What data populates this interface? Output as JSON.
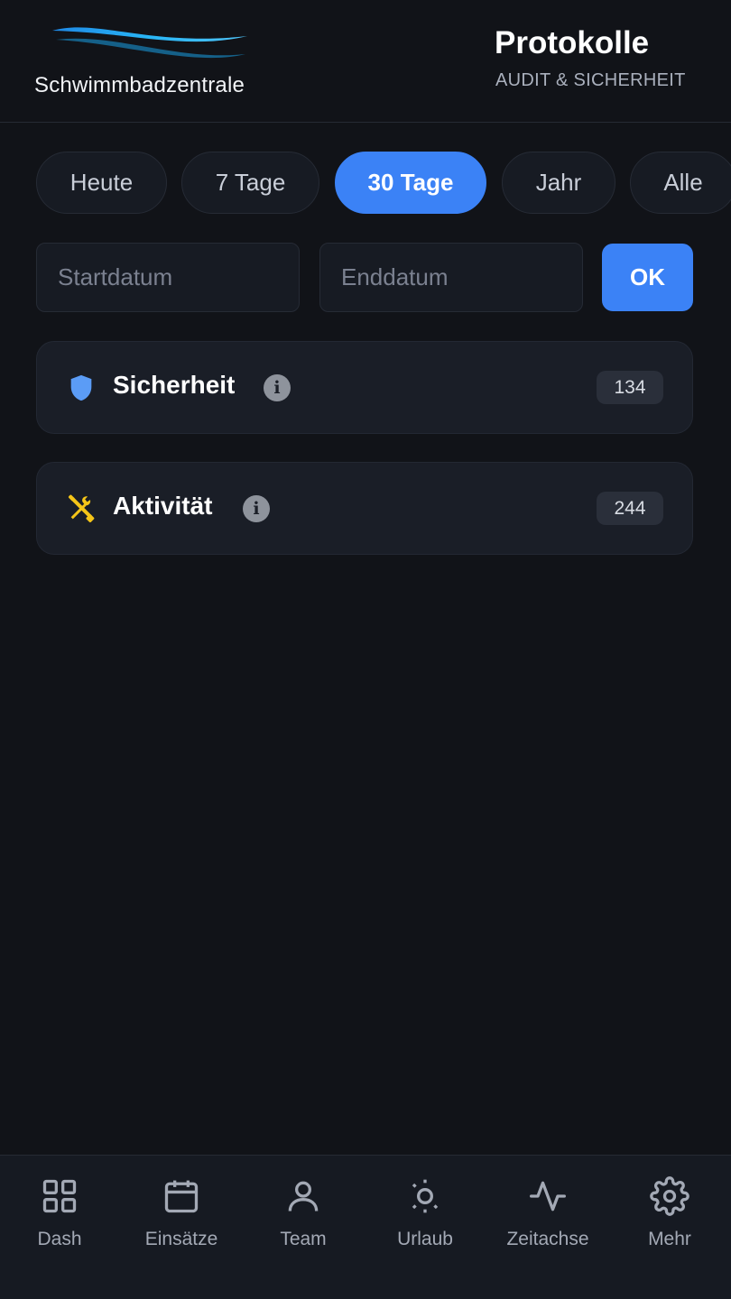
{
  "app": {
    "logo_text": "Schwimmbadzentrale",
    "title": "Protokolle",
    "subtitle": "AUDIT & SICHERHEIT"
  },
  "filters": {
    "chips": [
      {
        "label": "Heute",
        "active": false
      },
      {
        "label": "7 Tage",
        "active": false
      },
      {
        "label": "30 Tage",
        "active": true
      },
      {
        "label": "Jahr",
        "active": false
      },
      {
        "label": "Alle",
        "active": false
      }
    ],
    "start_placeholder": "Startdatum",
    "end_placeholder": "Enddatum",
    "ok_label": "OK"
  },
  "categories": [
    {
      "title": "Sicherheit",
      "count": "134",
      "icon": "shield-icon",
      "color": "#5b9cf6"
    },
    {
      "title": "Aktivität",
      "count": "244",
      "icon": "tools-icon",
      "color": "#f5c518"
    }
  ],
  "nav": {
    "items": [
      {
        "label": "Dash",
        "icon": "grid-icon"
      },
      {
        "label": "Einsätze",
        "icon": "calendar-icon"
      },
      {
        "label": "Team",
        "icon": "user-icon"
      },
      {
        "label": "Urlaub",
        "icon": "sun-icon"
      },
      {
        "label": "Zeitachse",
        "icon": "activity-icon"
      },
      {
        "label": "Mehr",
        "icon": "gear-icon"
      }
    ]
  },
  "colors": {
    "background": "#111318",
    "accent": "#3b82f6",
    "card": "#1a1e27"
  }
}
